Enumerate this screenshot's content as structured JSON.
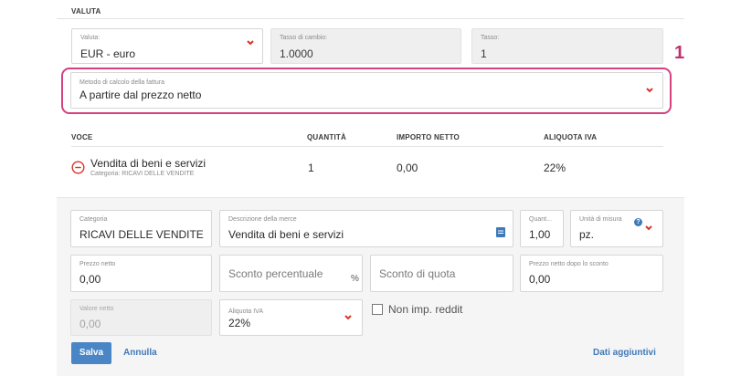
{
  "section": {
    "title": "VALUTA"
  },
  "currency": {
    "valuta_label": "Valuta:",
    "valuta_value": "EUR - euro",
    "tasso_cambio_label": "Tasso di cambio:",
    "tasso_cambio_value": "1.0000",
    "tasso_label": "Tasso:",
    "tasso_value": "1"
  },
  "calc_method": {
    "label": "Metodo di calcolo della fattura",
    "value": "A partire dal prezzo netto"
  },
  "callout": {
    "number": "1"
  },
  "table": {
    "headers": {
      "voce": "VOCE",
      "quantita": "QUANTITÀ",
      "importo": "IMPORTO NETTO",
      "aliquota": "ALIQUOTA IVA"
    },
    "rows": [
      {
        "title": "Vendita di beni e servizi",
        "category": "Categoria: RICAVI DELLE VENDITE",
        "quantity": "1",
        "net_amount": "0,00",
        "vat": "22%"
      }
    ]
  },
  "edit": {
    "categoria_label": "Categoria",
    "categoria_value": "RICAVI DELLE VENDITE",
    "descrizione_label": "Descrizione della merce",
    "descrizione_value": "Vendita di beni e servizi",
    "quantita_label": "Quant...",
    "quantita_value": "1,00",
    "unita_label": "Unità di misura",
    "unita_value": "pz.",
    "prezzo_netto_label": "Prezzo netto",
    "prezzo_netto_value": "0,00",
    "sconto_perc_placeholder": "Sconto percentuale",
    "percent_symbol": "%",
    "sconto_quota_placeholder": "Sconto di quota",
    "prezzo_scontato_label": "Prezzo netto dopo lo sconto",
    "prezzo_scontato_value": "0,00",
    "valore_netto_label": "Valore netto",
    "valore_netto_value": "0,00",
    "aliquota_label": "Aliquota IVA",
    "aliquota_value": "22%",
    "non_imp_label": "Non imp. reddit"
  },
  "actions": {
    "save": "Salva",
    "cancel": "Annulla",
    "extra": "Dati aggiuntivi"
  },
  "colors": {
    "accent": "#4a86c5",
    "link": "#3f79b8",
    "highlight": "#d6407f",
    "error": "#d9342b"
  },
  "icons": {
    "dropdown": "chevron-down-icon",
    "remove": "minus-circle-icon",
    "note": "note-icon",
    "help": "help-icon"
  }
}
